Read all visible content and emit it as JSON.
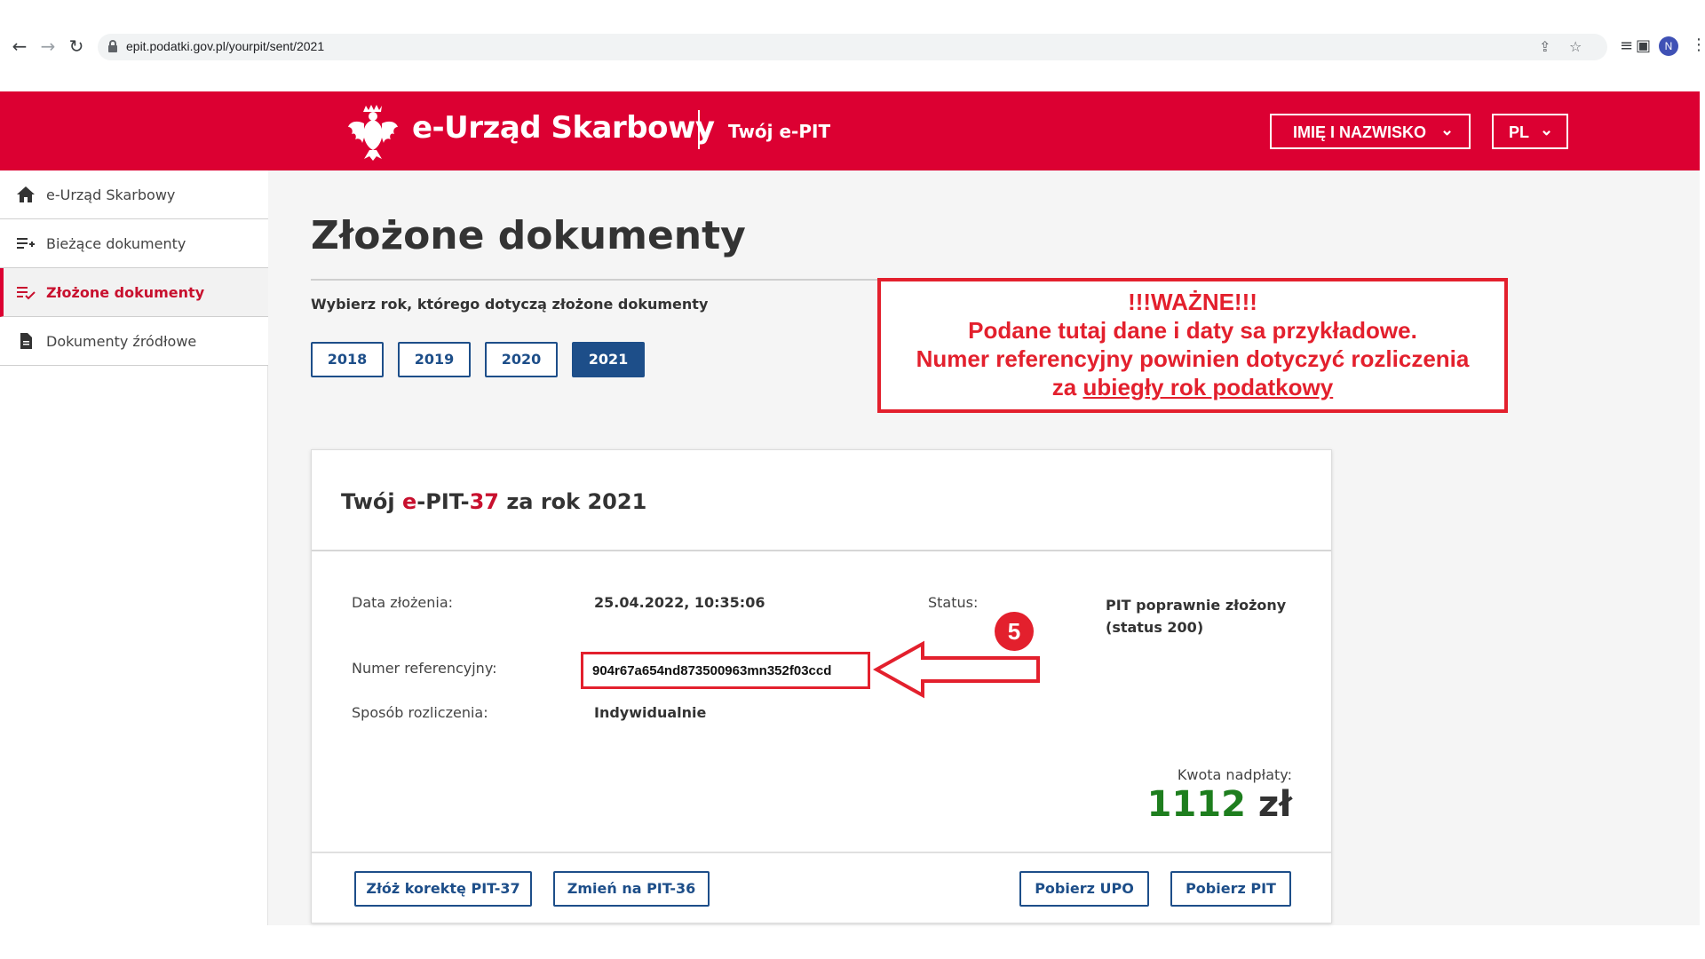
{
  "browser": {
    "url": "epit.podatki.gov.pl/yourpit/sent/2021",
    "profile_initial": "N"
  },
  "header": {
    "brand": "e-Urząd Skarbowy",
    "subbrand": "Twój e-PIT",
    "user_button": "IMIĘ I NAZWISKO",
    "lang_button": "PL",
    "bg_color": "#dc0032"
  },
  "sidebar": {
    "items": [
      {
        "label": "e-Urząd Skarbowy",
        "icon": "home-icon",
        "active": false
      },
      {
        "label": "Bieżące dokumenty",
        "icon": "playlist-add-icon",
        "active": false
      },
      {
        "label": "Złożone dokumenty",
        "icon": "playlist-check-icon",
        "active": true
      },
      {
        "label": "Dokumenty źródłowe",
        "icon": "document-icon",
        "active": false
      }
    ]
  },
  "main": {
    "title": "Złożone dokumenty",
    "choose_year_label": "Wybierz rok, którego dotyczą złożone dokumenty",
    "years": [
      "2018",
      "2019",
      "2020",
      "2021"
    ],
    "selected_year": "2021"
  },
  "callout": {
    "line1": "!!!WAŻNE!!!",
    "line2": "Podane tutaj dane i daty sa przykładowe.",
    "line3": "Numer referencyjny powinien dotyczyć rozliczenia",
    "line4_prefix": "za ",
    "line4_underlined": "ubiegły rok podatkowy",
    "color": "#e3202d"
  },
  "card": {
    "title_prefix": "Twój ",
    "title_e": "e",
    "title_mid": "-PIT-",
    "title_num": "37",
    "title_suffix": " za rok 2021",
    "date_label": "Data złożenia:",
    "date_value": "25.04.2022, 10:35:06",
    "status_label": "Status:",
    "status_value_line1": "PIT poprawnie złożony",
    "status_value_line2": "(status 200)",
    "ref_label": "Numer referencyjny:",
    "ref_value": "904r67a654nd873500963mn352f03ccd",
    "method_label": "Sposób rozliczenia:",
    "method_value": "Indywidualnie",
    "step_badge": "5",
    "amount_label": "Kwota nadpłaty:",
    "amount_value": "1112",
    "amount_currency": " zł",
    "buttons": {
      "correction": "Złóż korektę PIT-37",
      "change": "Zmień na PIT-36",
      "upo": "Pobierz UPO",
      "pit": "Pobierz PIT"
    }
  }
}
